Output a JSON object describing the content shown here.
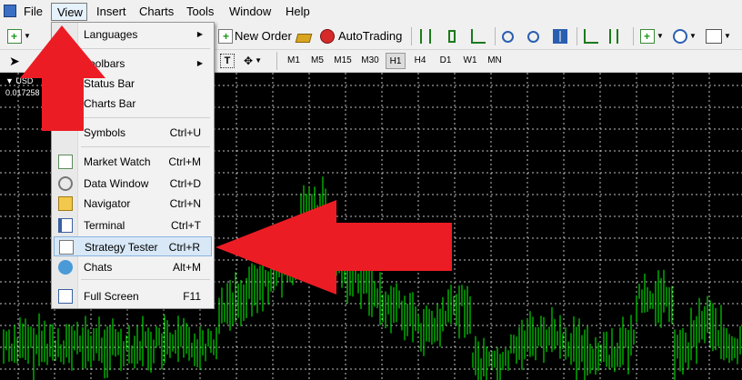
{
  "menubar": {
    "items": [
      {
        "label": "File"
      },
      {
        "label": "View"
      },
      {
        "label": "Insert"
      },
      {
        "label": "Charts"
      },
      {
        "label": "Tools"
      },
      {
        "label": "Window"
      },
      {
        "label": "Help"
      }
    ]
  },
  "toolbar": {
    "new_order_label": "New Order",
    "autotrading_label": "AutoTrading"
  },
  "timeframes": [
    "M1",
    "M5",
    "M15",
    "M30",
    "H1",
    "H4",
    "D1",
    "W1",
    "MN"
  ],
  "selected_timeframe": "H1",
  "chart": {
    "symbol": "USD",
    "price": "0.017258",
    "background": "#000000",
    "bar_color": "#00ff00",
    "grid_color": "#ffffff"
  },
  "view_menu": {
    "items": [
      {
        "label": "Languages",
        "shortcut": "",
        "submenu": true,
        "icon": ""
      },
      {
        "label": "Toolbars",
        "shortcut": "",
        "submenu": true,
        "icon": ""
      },
      {
        "label": "Status Bar",
        "shortcut": "",
        "submenu": false,
        "icon": ""
      },
      {
        "label": "Charts Bar",
        "shortcut": "",
        "submenu": false,
        "icon": ""
      },
      {
        "label": "Symbols",
        "shortcut": "Ctrl+U",
        "submenu": false,
        "icon": ""
      },
      {
        "label": "Market Watch",
        "shortcut": "Ctrl+M",
        "submenu": false,
        "icon": "market-watch-icon"
      },
      {
        "label": "Data Window",
        "shortcut": "Ctrl+D",
        "submenu": false,
        "icon": "data-window-icon"
      },
      {
        "label": "Navigator",
        "shortcut": "Ctrl+N",
        "submenu": false,
        "icon": "navigator-icon"
      },
      {
        "label": "Terminal",
        "shortcut": "Ctrl+T",
        "submenu": false,
        "icon": "terminal-icon"
      },
      {
        "label": "Strategy Tester",
        "shortcut": "Ctrl+R",
        "submenu": false,
        "icon": "strategy-tester-icon"
      },
      {
        "label": "Chats",
        "shortcut": "Alt+M",
        "submenu": false,
        "icon": "chats-icon"
      },
      {
        "label": "Full Screen",
        "shortcut": "F11",
        "submenu": false,
        "icon": "full-screen-icon"
      }
    ],
    "highlighted": "Strategy Tester"
  },
  "annotation": {
    "arrow_color": "#ec1c24"
  }
}
